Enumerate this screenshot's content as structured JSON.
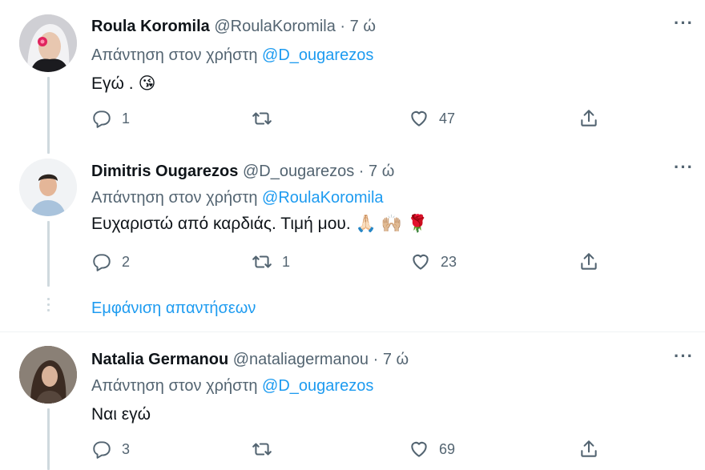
{
  "tweets": [
    {
      "name": "Roula Koromila",
      "handle": "@RoulaKoromila",
      "dot": "·",
      "time": "7 ώ",
      "reply_prefix": "Απάντηση στον χρήστη",
      "reply_to": "@D_ougarezos",
      "text": "Εγώ .",
      "emojis": [
        "😘"
      ],
      "replies": "1",
      "retweets": "",
      "likes": "47",
      "more": "···"
    },
    {
      "name": "Dimitris Ougarezos",
      "handle": "@D_ougarezos",
      "dot": "·",
      "time": "7 ώ",
      "reply_prefix": "Απάντηση στον χρήστη",
      "reply_to": "@RoulaKoromila",
      "text": "Ευχαριστώ από καρδιάς. Τιμή μου.",
      "emojis": [
        "🙏🏻",
        "🙌🏼",
        "🌹"
      ],
      "replies": "2",
      "retweets": "1",
      "likes": "23",
      "more": "···"
    },
    {
      "name": "Natalia Germanou",
      "handle": "@nataliagermanou",
      "dot": "·",
      "time": "7 ώ",
      "reply_prefix": "Απάντηση στον χρήστη",
      "reply_to": "@D_ougarezos",
      "text": "Ναι εγώ",
      "emojis": [],
      "replies": "3",
      "retweets": "",
      "likes": "69",
      "more": "···"
    }
  ],
  "show_replies": "Εμφάνιση απαντήσεων",
  "colors": {
    "accent": "#1d9bf0",
    "muted": "#536471",
    "text": "#0f1419",
    "thread": "#cfd9de"
  },
  "icons": [
    "reply-icon",
    "retweet-icon",
    "like-icon",
    "share-icon",
    "more-icon"
  ]
}
